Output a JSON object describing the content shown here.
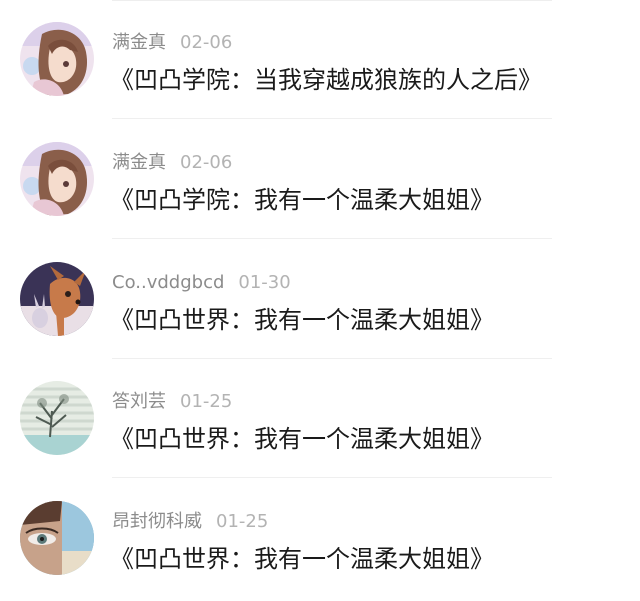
{
  "feed": {
    "items": [
      {
        "author": "满金真",
        "date": "02-06",
        "title": "《凹凸学院：当我穿越成狼族的人之后》",
        "avatar": "anime-girl-avatar"
      },
      {
        "author": "满金真",
        "date": "02-06",
        "title": "《凹凸学院：我有一个温柔大姐姐》",
        "avatar": "anime-girl-avatar"
      },
      {
        "author": "Co..vddgbcd",
        "date": "01-30",
        "title": "《凹凸世界：我有一个温柔大姐姐》",
        "avatar": "fawn-bunny-avatar"
      },
      {
        "author": "答刘芸",
        "date": "01-25",
        "title": "《凹凸世界：我有一个温柔大姐姐》",
        "avatar": "tree-blinds-avatar"
      },
      {
        "author": "昂封彻科威",
        "date": "01-25",
        "title": "《凹凸世界：我有一个温柔大姐姐》",
        "avatar": "eye-closeup-avatar"
      }
    ]
  }
}
